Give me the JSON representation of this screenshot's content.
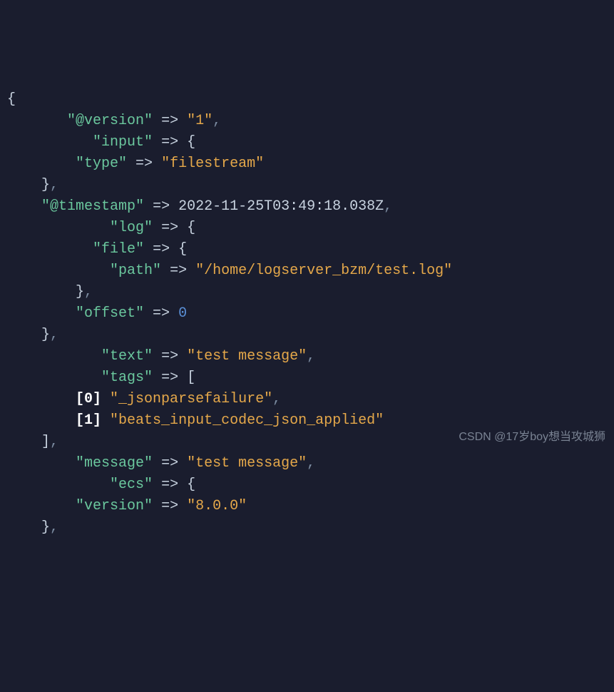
{
  "code": {
    "keys": {
      "version": "\"@version\"",
      "input": "\"input\"",
      "type": "\"type\"",
      "timestamp": "\"@timestamp\"",
      "log": "\"log\"",
      "file": "\"file\"",
      "path": "\"path\"",
      "offset": "\"offset\"",
      "text": "\"text\"",
      "tags": "\"tags\"",
      "message": "\"message\"",
      "ecs": "\"ecs\"",
      "version2": "\"version\""
    },
    "values": {
      "version": "\"1\"",
      "type": "\"filestream\"",
      "timestamp": "2022-11-25T03:49:18.038Z",
      "path": "\"/home/logserver_bzm/test.log\"",
      "offset": "0",
      "text": "\"test message\"",
      "tag0": "\"_jsonparsefailure\"",
      "tag1": "\"beats_input_codec_json_applied\"",
      "message": "\"test message\"",
      "ecs_version": "\"8.0.0\""
    },
    "indices": {
      "i0": "[0]",
      "i1": "[1]"
    },
    "arrow": "=>",
    "watermark": "CSDN @17岁boy想当攻城狮"
  }
}
